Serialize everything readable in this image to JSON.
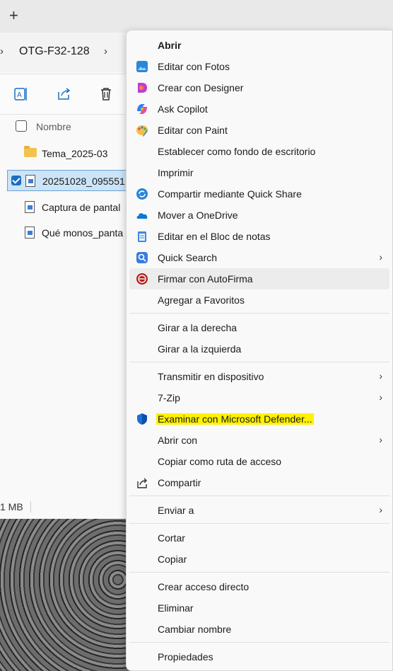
{
  "tabbar": {
    "new_tab_symbol": "+"
  },
  "explorer": {
    "breadcrumb": "OTG-F32-128",
    "column_header": "Nombre",
    "files": [
      {
        "name": "Tema_2025-03",
        "type": "folder",
        "selected": false
      },
      {
        "name": "20251028_095551",
        "type": "image",
        "selected": true
      },
      {
        "name": "Captura de pantal",
        "type": "image",
        "selected": false
      },
      {
        "name": "Qué monos_panta",
        "type": "image",
        "selected": false
      }
    ],
    "status_size": "1 MB"
  },
  "menu": {
    "items": [
      {
        "label": "Abrir",
        "bold": true,
        "icon": ""
      },
      {
        "label": "Editar con Fotos",
        "icon": "photos-icon"
      },
      {
        "label": "Crear con Designer",
        "icon": "designer-icon"
      },
      {
        "label": "Ask Copilot",
        "icon": "copilot-icon"
      },
      {
        "label": "Editar con Paint",
        "icon": "paint-icon"
      },
      {
        "label": "Establecer como fondo de escritorio",
        "icon": ""
      },
      {
        "label": "Imprimir",
        "icon": ""
      },
      {
        "label": "Compartir mediante Quick Share",
        "icon": "quick-share-icon"
      },
      {
        "label": "Mover a OneDrive",
        "icon": "onedrive-icon"
      },
      {
        "label": "Editar en el Bloc de notas",
        "icon": "notepad-icon"
      },
      {
        "label": "Quick Search",
        "icon": "quick-search-icon",
        "submenu": true
      },
      {
        "label": "Firmar con AutoFirma",
        "icon": "autofirma-icon",
        "hover": true
      },
      {
        "label": "Agregar a Favoritos",
        "icon": ""
      },
      {
        "label": "Girar a la derecha",
        "icon": ""
      },
      {
        "label": "Girar a la izquierda",
        "icon": ""
      },
      {
        "label": "Transmitir en dispositivo",
        "icon": "",
        "submenu": true
      },
      {
        "label": "7-Zip",
        "icon": "",
        "submenu": true
      },
      {
        "label": "Examinar con Microsoft Defender...",
        "icon": "defender-icon",
        "highlighted": true
      },
      {
        "label": "Abrir con",
        "icon": "",
        "submenu": true
      },
      {
        "label": "Copiar como ruta de acceso",
        "icon": ""
      },
      {
        "label": "Compartir",
        "icon": "share-icon"
      },
      {
        "label": "Enviar a",
        "icon": "",
        "submenu": true
      },
      {
        "label": "Cortar",
        "icon": ""
      },
      {
        "label": "Copiar",
        "icon": ""
      },
      {
        "label": "Crear acceso directo",
        "icon": ""
      },
      {
        "label": "Eliminar",
        "icon": ""
      },
      {
        "label": "Cambiar nombre",
        "icon": ""
      },
      {
        "label": "Propiedades",
        "icon": ""
      }
    ],
    "submenu_arrow": "›",
    "highlight_color": "#fff200"
  }
}
